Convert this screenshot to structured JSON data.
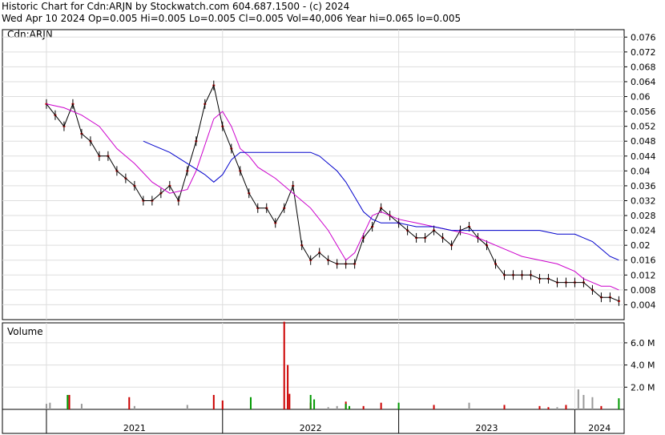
{
  "header": {
    "line1": "Historic Chart for Cdn:ARJN by Stockwatch.com 604.687.1500 - (c) 2024",
    "line2": "Wed Apr 10 2024   Op=0.005   Hi=0.005   Lo=0.005   Cl=0.005   Vol=40,006   Year hi=0.065   lo=0.005"
  },
  "chart_data": [
    {
      "type": "line",
      "title": "Cdn:ARJN",
      "ylim": [
        0,
        0.078
      ],
      "yticks": [
        "0.004",
        "0.008",
        "0.012",
        "0.016",
        "0.02",
        "0.024",
        "0.028",
        "0.032",
        "0.036",
        "0.04",
        "0.044",
        "0.048",
        "0.052",
        "0.056",
        "0.06",
        "0.064",
        "0.068",
        "0.072",
        "0.076"
      ],
      "xticks": [
        "2021",
        "2022",
        "2023",
        "2024"
      ],
      "grid": true,
      "series": [
        {
          "role": "price",
          "color": "#000000",
          "x": [
            2021.0,
            2021.05,
            2021.1,
            2021.15,
            2021.2,
            2021.25,
            2021.3,
            2021.35,
            2021.4,
            2021.45,
            2021.5,
            2021.55,
            2021.6,
            2021.65,
            2021.7,
            2021.75,
            2021.8,
            2021.85,
            2021.9,
            2021.95,
            2022.0,
            2022.05,
            2022.1,
            2022.15,
            2022.2,
            2022.25,
            2022.3,
            2022.35,
            2022.4,
            2022.45,
            2022.5,
            2022.55,
            2022.6,
            2022.65,
            2022.7,
            2022.75,
            2022.8,
            2022.85,
            2022.9,
            2022.95,
            2023.0,
            2023.05,
            2023.1,
            2023.15,
            2023.2,
            2023.25,
            2023.3,
            2023.35,
            2023.4,
            2023.45,
            2023.5,
            2023.55,
            2023.6,
            2023.65,
            2023.7,
            2023.75,
            2023.8,
            2023.85,
            2023.9,
            2023.95,
            2024.0,
            2024.05,
            2024.1,
            2024.15,
            2024.2,
            2024.25
          ],
          "values": [
            0.058,
            0.055,
            0.052,
            0.058,
            0.05,
            0.048,
            0.044,
            0.044,
            0.04,
            0.038,
            0.036,
            0.032,
            0.032,
            0.034,
            0.036,
            0.032,
            0.04,
            0.048,
            0.058,
            0.063,
            0.052,
            0.046,
            0.04,
            0.034,
            0.03,
            0.03,
            0.026,
            0.03,
            0.036,
            0.02,
            0.016,
            0.018,
            0.016,
            0.015,
            0.015,
            0.015,
            0.022,
            0.025,
            0.03,
            0.028,
            0.026,
            0.024,
            0.022,
            0.022,
            0.024,
            0.022,
            0.02,
            0.024,
            0.025,
            0.022,
            0.02,
            0.015,
            0.012,
            0.012,
            0.012,
            0.012,
            0.011,
            0.011,
            0.01,
            0.01,
            0.01,
            0.01,
            0.008,
            0.006,
            0.006,
            0.005
          ]
        },
        {
          "role": "moving-average-short",
          "color": "#cc00cc",
          "x": [
            2021.0,
            2021.1,
            2021.2,
            2021.3,
            2021.4,
            2021.5,
            2021.6,
            2021.7,
            2021.8,
            2021.85,
            2021.9,
            2021.95,
            2022.0,
            2022.05,
            2022.1,
            2022.15,
            2022.2,
            2022.3,
            2022.4,
            2022.45,
            2022.5,
            2022.55,
            2022.6,
            2022.65,
            2022.7,
            2022.75,
            2022.8,
            2022.85,
            2022.9,
            2022.95,
            2023.0,
            2023.1,
            2023.2,
            2023.3,
            2023.4,
            2023.5,
            2023.6,
            2023.7,
            2023.8,
            2023.9,
            2024.0,
            2024.05,
            2024.1,
            2024.15,
            2024.2,
            2024.25
          ],
          "values": [
            0.058,
            0.057,
            0.055,
            0.052,
            0.046,
            0.042,
            0.037,
            0.034,
            0.035,
            0.04,
            0.047,
            0.054,
            0.056,
            0.052,
            0.046,
            0.044,
            0.041,
            0.038,
            0.034,
            0.032,
            0.03,
            0.027,
            0.024,
            0.02,
            0.016,
            0.018,
            0.023,
            0.028,
            0.029,
            0.028,
            0.027,
            0.026,
            0.025,
            0.024,
            0.023,
            0.021,
            0.019,
            0.017,
            0.016,
            0.015,
            0.013,
            0.011,
            0.01,
            0.009,
            0.009,
            0.008
          ]
        },
        {
          "role": "moving-average-long",
          "color": "#0000cc",
          "x": [
            2021.55,
            2021.6,
            2021.7,
            2021.8,
            2021.9,
            2021.95,
            2022.0,
            2022.05,
            2022.1,
            2022.2,
            2022.3,
            2022.4,
            2022.5,
            2022.55,
            2022.6,
            2022.65,
            2022.7,
            2022.75,
            2022.8,
            2022.85,
            2022.9,
            2023.0,
            2023.1,
            2023.2,
            2023.3,
            2023.4,
            2023.5,
            2023.6,
            2023.7,
            2023.8,
            2023.9,
            2024.0,
            2024.05,
            2024.1,
            2024.15,
            2024.2,
            2024.25
          ],
          "values": [
            0.048,
            0.047,
            0.045,
            0.042,
            0.039,
            0.037,
            0.039,
            0.043,
            0.045,
            0.045,
            0.045,
            0.045,
            0.045,
            0.044,
            0.042,
            0.04,
            0.037,
            0.033,
            0.029,
            0.027,
            0.026,
            0.026,
            0.025,
            0.025,
            0.024,
            0.024,
            0.024,
            0.024,
            0.024,
            0.024,
            0.023,
            0.023,
            0.022,
            0.021,
            0.019,
            0.017,
            0.016
          ]
        }
      ]
    },
    {
      "type": "bar",
      "title": "Volume",
      "ylim": [
        0,
        7800000
      ],
      "yticks": [
        "2.0 M",
        "4.0 M",
        "6.0 M"
      ],
      "series": [
        {
          "name": "",
          "color": "#cc0000",
          "x": [
            2021.13,
            2021.47,
            2021.95,
            2022.0,
            2022.35,
            2022.37,
            2022.38,
            2022.5,
            2022.7,
            2022.8,
            2022.9,
            2023.2,
            2023.6,
            2023.8,
            2023.85,
            2023.95,
            2024.15
          ],
          "values": [
            1300000,
            1100000,
            1300000,
            800000,
            7900000,
            4000000,
            1400000,
            600000,
            700000,
            300000,
            600000,
            400000,
            400000,
            300000,
            200000,
            400000,
            300000
          ]
        },
        {
          "name": "",
          "color": "#009900",
          "x": [
            2021.12,
            2022.16,
            2022.5,
            2022.52,
            2022.7,
            2022.72,
            2023.0,
            2024.25
          ],
          "values": [
            1300000,
            1100000,
            1300000,
            900000,
            500000,
            300000,
            600000,
            1000000
          ]
        },
        {
          "name": "",
          "color": "#999999",
          "x": [
            2021.0,
            2021.02,
            2021.2,
            2021.5,
            2021.8,
            2022.6,
            2022.65,
            2023.4,
            2023.9,
            2024.02,
            2024.05,
            2024.1
          ],
          "values": [
            500000,
            600000,
            500000,
            300000,
            400000,
            200000,
            300000,
            600000,
            200000,
            1800000,
            1300000,
            1100000
          ]
        }
      ]
    }
  ]
}
